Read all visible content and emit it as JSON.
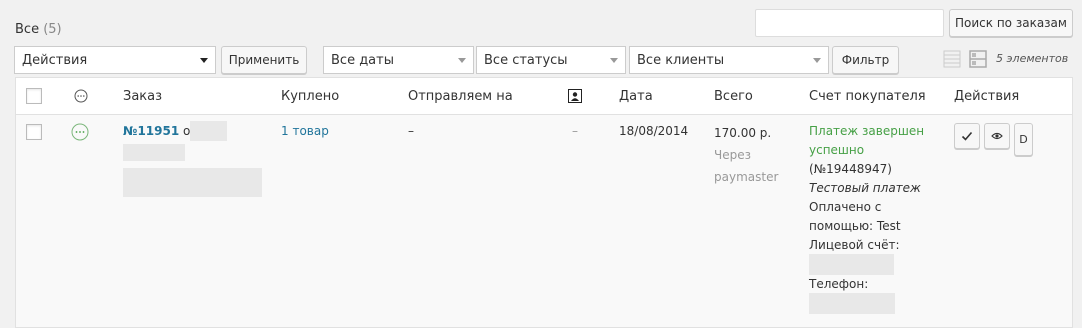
{
  "filter": {
    "all_label": "Все",
    "all_count": "(5)"
  },
  "search": {
    "button": "Поиск по заказам",
    "value": ""
  },
  "bulk": {
    "actions": "Действия",
    "apply": "Применить"
  },
  "filters": {
    "dates": "Все даты",
    "statuses": "Все статусы",
    "clients": "Все клиенты",
    "button": "Фильтр"
  },
  "items_count": "5 элементов",
  "columns": {
    "order": "Заказ",
    "purchased": "Куплено",
    "ship_to": "Отправляем на",
    "date": "Дата",
    "total": "Всего",
    "invoice": "Счет покупателя",
    "actions": "Действия"
  },
  "row": {
    "order_number": "№11951",
    "order_from": "от",
    "purchased": "1 товар",
    "ship_to": "–",
    "notes": "–",
    "date": "18/08/2014",
    "total": "170.00 р.",
    "via_line1": "Через",
    "via_line2": "paymaster",
    "invoice": {
      "status_line1": "Платеж завершен",
      "status_line2": "успешно",
      "payment_id": "(№19448947)",
      "test_payment": "Тестовый платеж",
      "paid_with_line1": "Оплачено с",
      "paid_with_line2": "помощью: Test",
      "account_label": "Лицевой счёт:",
      "phone_label": "Телефон:"
    },
    "action_icons": [
      "check-icon",
      "eye-icon"
    ],
    "action_d": "D"
  },
  "colors": {
    "link": "#21759b",
    "success": "#46a046"
  }
}
